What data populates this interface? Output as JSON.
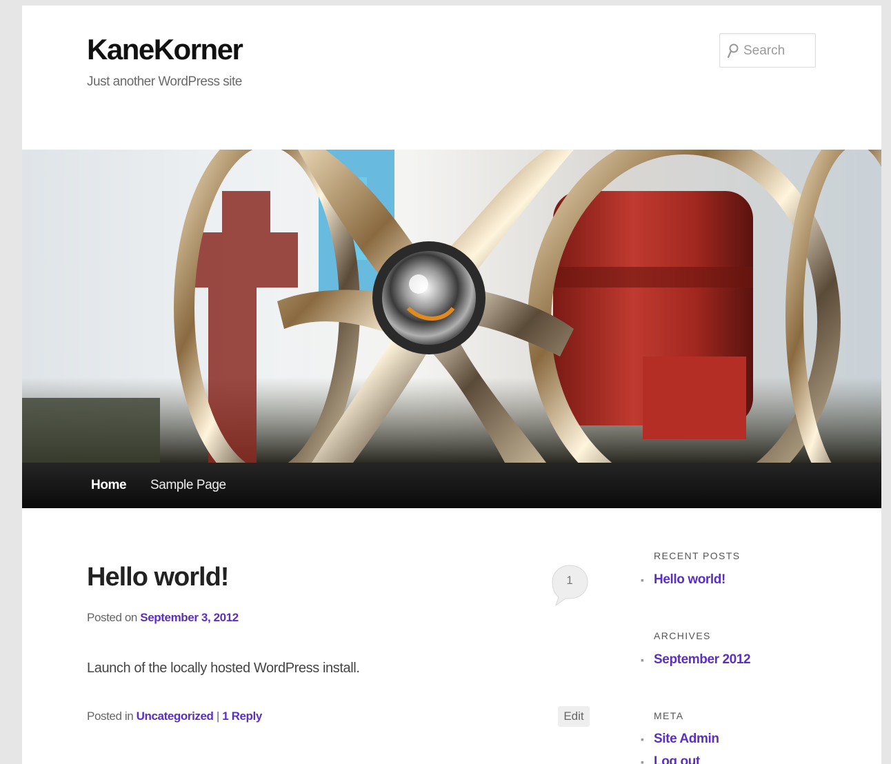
{
  "site": {
    "title": "KaneKorner",
    "description": "Just another WordPress site"
  },
  "search": {
    "placeholder": "Search",
    "icon": "search-icon"
  },
  "nav": {
    "items": [
      {
        "label": "Home",
        "active": true
      },
      {
        "label": "Sample Page",
        "active": false
      }
    ]
  },
  "post": {
    "title": "Hello world!",
    "comment_count": "1",
    "posted_on_prefix": "Posted on",
    "date": "September 3, 2012",
    "content": "Launch of the locally hosted WordPress install.",
    "posted_in_prefix": "Posted in",
    "category": "Uncategorized",
    "separator": "|",
    "reply_link": "1 Reply",
    "edit_label": "Edit"
  },
  "sidebar": {
    "recent_posts": {
      "title": "RECENT POSTS",
      "items": [
        "Hello world!"
      ]
    },
    "archives": {
      "title": "ARCHIVES",
      "items": [
        "September 2012"
      ]
    },
    "meta": {
      "title": "META",
      "items": [
        "Site Admin",
        "Log out"
      ]
    }
  },
  "colors": {
    "link": "#5a2fc4",
    "nav_bg": "#111111"
  }
}
